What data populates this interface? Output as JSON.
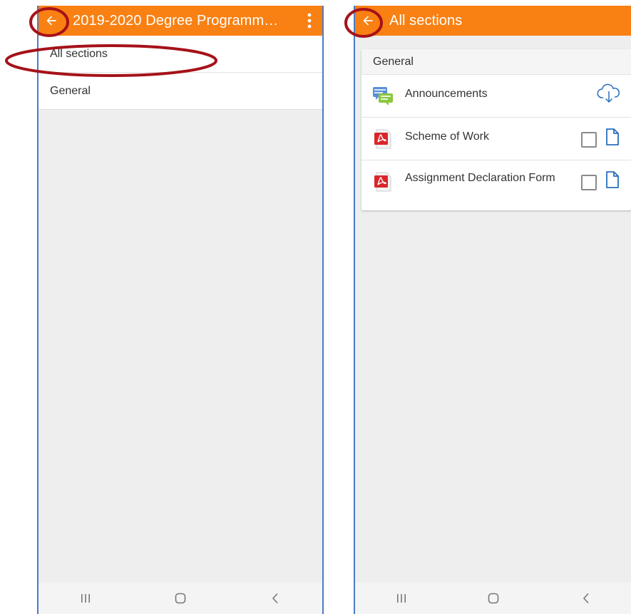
{
  "colors": {
    "accent": "#f98012",
    "annotation": "#a6121a",
    "frame": "#4a7cc4"
  },
  "left_screen": {
    "appbar": {
      "back_icon": "arrow-left-icon",
      "title": "2019-2020 Degree Programm…",
      "more_icon": "more-vertical-icon"
    },
    "sections": [
      {
        "label": "All sections"
      },
      {
        "label": "General"
      }
    ],
    "navbar": {
      "icons": [
        "recent-apps-icon",
        "home-icon",
        "back-chevron-icon"
      ]
    }
  },
  "right_screen": {
    "appbar": {
      "back_icon": "arrow-left-icon",
      "title": "All sections"
    },
    "section": {
      "title": "General",
      "modules": [
        {
          "label": "Announcements",
          "icon": "forum-icon",
          "action": "download-cloud-icon"
        },
        {
          "label": "Scheme of Work",
          "icon": "pdf-icon",
          "checkbox": "unchecked",
          "action": "document-icon"
        },
        {
          "label": "Assignment Declaration Form",
          "icon": "pdf-icon",
          "checkbox": "unchecked",
          "action": "document-icon"
        }
      ]
    },
    "navbar": {
      "icons": [
        "recent-apps-icon",
        "home-icon",
        "back-chevron-icon"
      ]
    }
  }
}
